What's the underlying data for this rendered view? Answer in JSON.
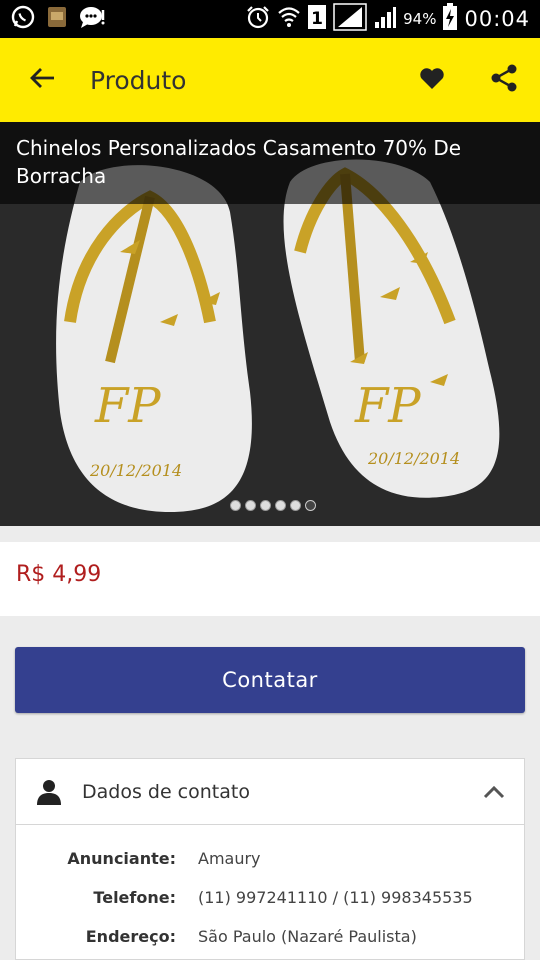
{
  "status_bar": {
    "left_icons": [
      "whatsapp-icon",
      "notification-app-icon",
      "chat-icon"
    ],
    "right_icons": [
      "alarm-icon",
      "wifi-icon",
      "sim-1-icon",
      "signal-icon",
      "signal-icon"
    ],
    "battery": "94%",
    "time": "00:04"
  },
  "appbar": {
    "title": "Produto",
    "icons": [
      "back-arrow-icon",
      "heart-icon",
      "share-icon"
    ]
  },
  "product": {
    "title": "Chinelos Personalizados Casamento  70% De Borracha",
    "photo_text_left_initials": "FP",
    "photo_text_left_date": "20/12/2014",
    "photo_text_right_initials": "FP",
    "photo_text_right_date": "20/12/2014",
    "carousel": {
      "count": 6,
      "active_index": 5
    }
  },
  "price": "R$ 4,99",
  "contact_button": "Contatar",
  "contact": {
    "header": "Dados de contato",
    "rows": [
      {
        "label": "Anunciante:",
        "value": "Amaury"
      },
      {
        "label": "Telefone:",
        "value": "(11) 997241110 / (11) 998345535"
      },
      {
        "label": "Endereço:",
        "value": "São Paulo (Nazaré Paulista)"
      }
    ]
  },
  "colors": {
    "appbar": "#ffeb00",
    "button": "#34408f",
    "price": "#b01e1e",
    "gold": "#c9a227"
  }
}
